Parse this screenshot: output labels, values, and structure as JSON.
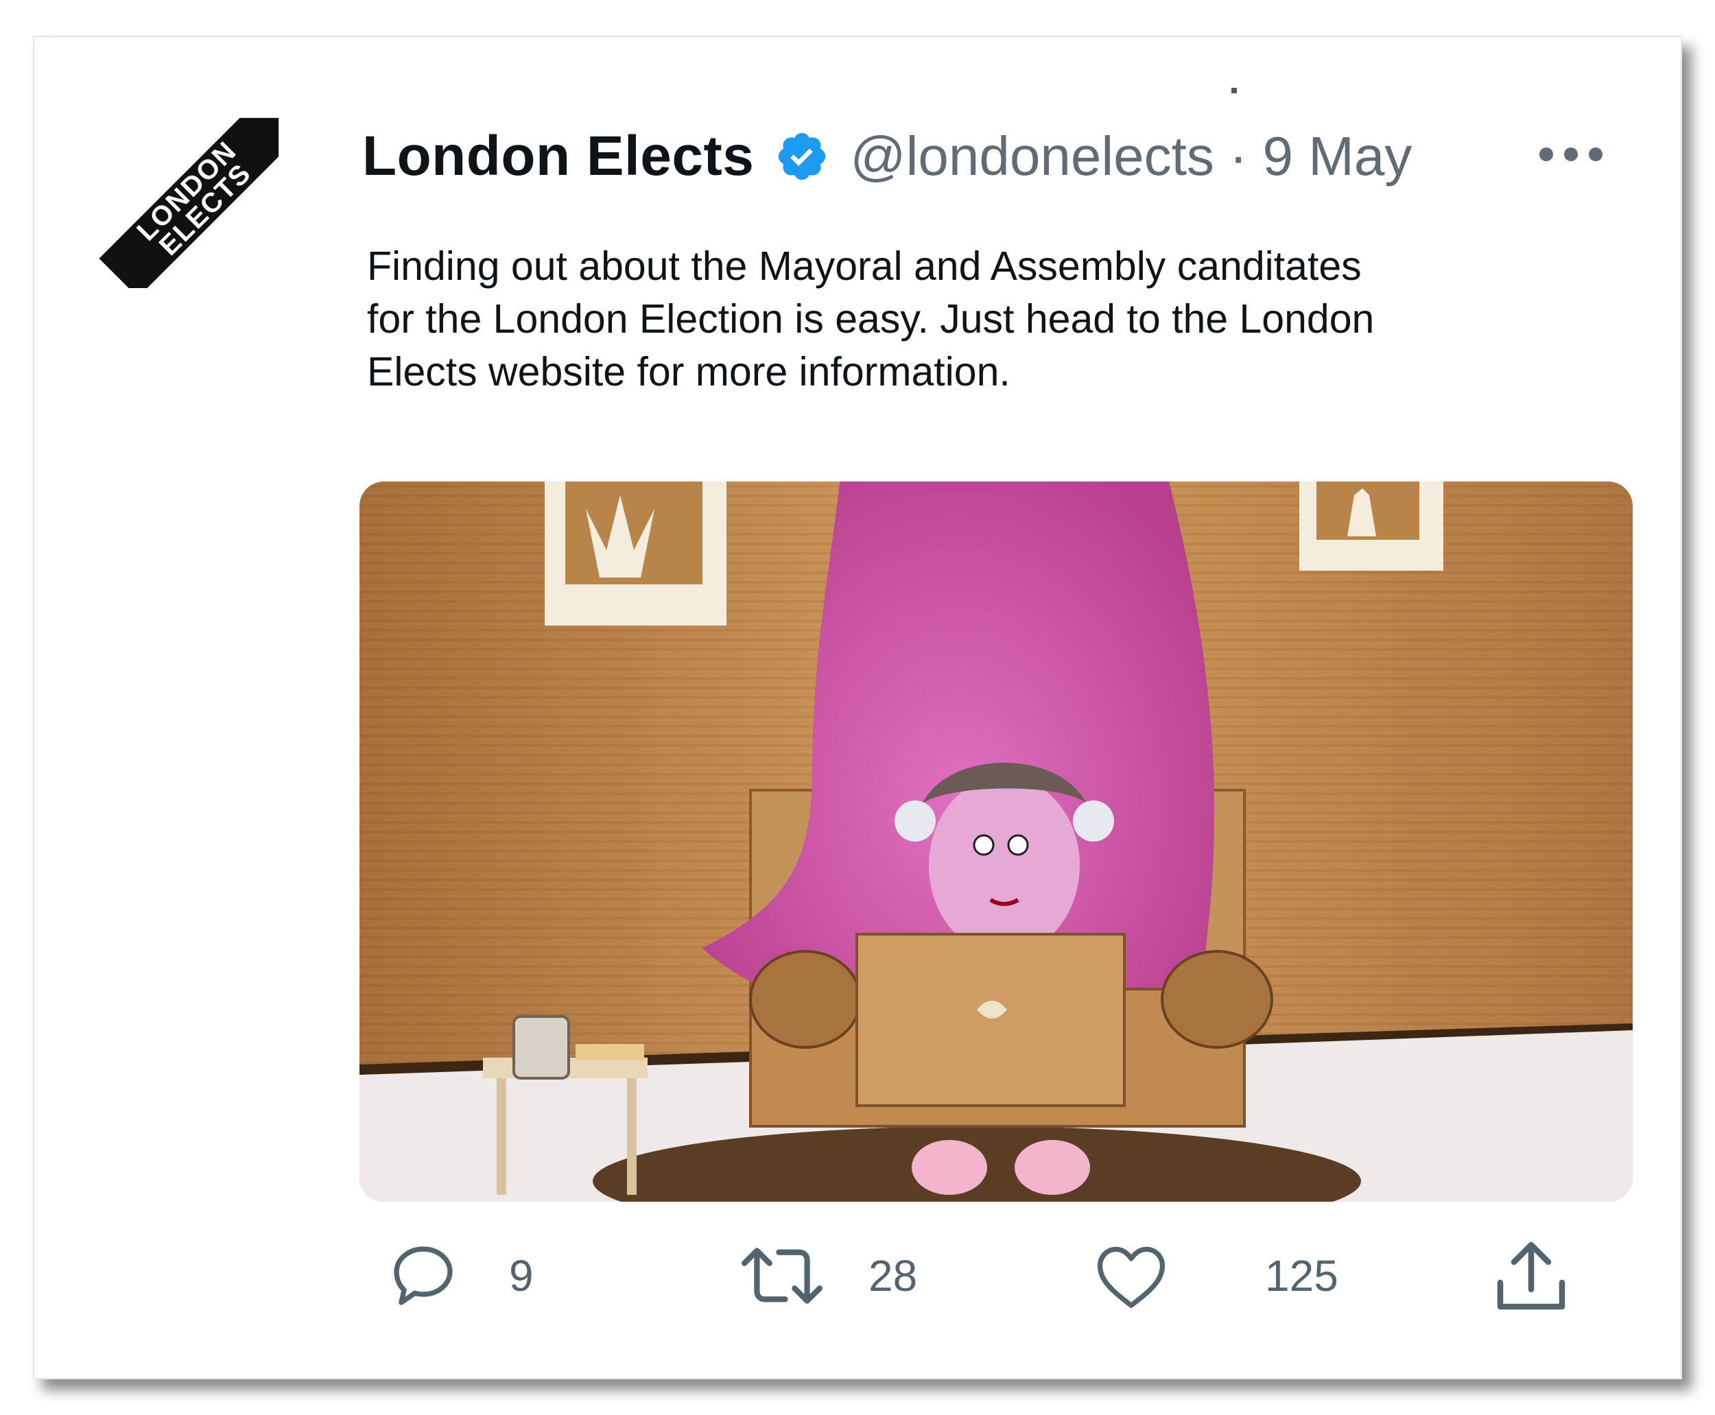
{
  "tweet": {
    "display_name": "London Elects",
    "verified": true,
    "handle": "@londonelects",
    "separator": "·",
    "date": "9 May",
    "more_icon": "more-horizontal-icon",
    "text": "Finding out about the Mayoral and Assembly canditates\nfor the London Election is easy. Just head to the London\nElects website for more information.",
    "avatar": {
      "logo_lines": [
        "LONDON",
        "ELECTS"
      ]
    },
    "media": {
      "description_icon": "photo"
    }
  },
  "actions": {
    "reply": {
      "icon": "reply-icon",
      "count": "9"
    },
    "retweet": {
      "icon": "retweet-icon",
      "count": "28"
    },
    "like": {
      "icon": "heart-icon",
      "count": "125"
    },
    "share": {
      "icon": "share-icon"
    }
  },
  "colors": {
    "verified_blue": "#1d9bf0",
    "text_primary": "#0f1419",
    "text_secondary": "#606b76"
  }
}
